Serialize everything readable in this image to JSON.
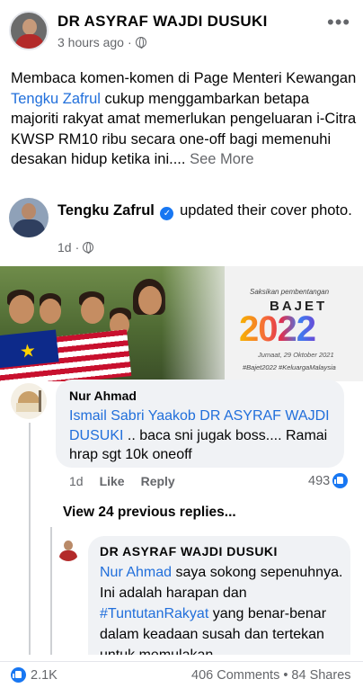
{
  "post": {
    "author": "DR ASYRAF WAJDI DUSUKI",
    "time": "3 hours ago",
    "more_icon": "•••",
    "text_before": "Membaca komen-komen di Page Menteri Kewangan ",
    "mention": "Tengku Zafrul",
    "text_after": " cukup menggambarkan betapa majoriti rakyat amat memerlukan pengeluaran i-Citra KWSP RM10 ribu secara one-off bagi memenuhi desakan hidup ketika ini....",
    "see_more": "See More"
  },
  "shared": {
    "name": "Tengku Zafrul",
    "action": "updated their cover photo.",
    "time": "1d",
    "verified_glyph": "✓"
  },
  "cover": {
    "subtitle": "Saksikan pembentangan",
    "heading": "BAJET",
    "year": "2022",
    "date": "Jumaat, 29 Oktober 2021",
    "tags": "#Bajet2022 #KeluargaMalaysia"
  },
  "comment1": {
    "author": "Nur Ahmad",
    "mention1": "Ismail Sabri Yaakob",
    "mention2": "DR ASYRAF WAJDI DUSUKI",
    "text": " .. baca sni jugak boss.... Ramai hrap sgt 10k oneoff",
    "time": "1d",
    "like_label": "Like",
    "reply_label": "Reply",
    "reaction_count": "493"
  },
  "view_previous": "View 24 previous replies...",
  "comment2": {
    "author": "DR ASYRAF WAJDI DUSUKI",
    "mention": "Nur Ahmad",
    "text1": " saya sokong sepenuhnya. Ini adalah harapan dan ",
    "hashtag": "#TuntutanRakyat",
    "text2": " yang benar-benar dalam keadaan susah dan tertekan untuk memulakan"
  },
  "footer": {
    "likes": "2.1K",
    "comments": "406 Comments",
    "separator": "•",
    "shares": "84 Shares"
  },
  "colors": {
    "link": "#216fdb",
    "facebook_blue": "#1877f2",
    "muted_text": "#65676b",
    "bubble": "#f0f2f5"
  }
}
